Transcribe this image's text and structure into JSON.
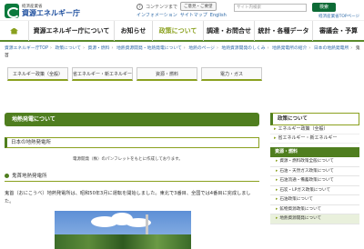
{
  "header": {
    "ministry": "経済産業省",
    "agency": "資源エネルギー庁",
    "util_contents_icon": "?",
    "util_contents": "コンテンツまで",
    "text_size_label": "ご意見・ご要望",
    "search_placeholder": "サイト内検索",
    "search_button": "検索",
    "links": [
      "インフォメーション",
      "サイトマップ",
      "English"
    ],
    "top_page_link": "経済産業省TOPページ"
  },
  "gnav": {
    "items": [
      "ホーム",
      "資源エネルギー庁について",
      "お知らせ",
      "政策について",
      "調達・お問合せ",
      "統計・各種データ",
      "審議会・予算"
    ],
    "active_index": 3,
    "accent": "#8aa01e"
  },
  "breadcrumb": {
    "items": [
      "資源エネルギー庁TOP",
      "政策について",
      "資源・燃料",
      "地熱資源開発・地熱発電について",
      "地熱のページ",
      "地熱資源開発のしくみ",
      "地熱発電所の紹介",
      "日本の地熱発電所"
    ],
    "current": "鬼首"
  },
  "tabs": [
    "エネルギー政策（全般）",
    "省エネルギー・新エネルギー",
    "資源・燃料",
    "電力・ガス"
  ],
  "main": {
    "section_title": "地熱発電について",
    "subsection_title": "日本の地熱発電所",
    "caption": "電源開発（株）のパンフレットをもとに作成しております。",
    "plant_heading": "鬼首地熱発電所",
    "plant_body": "鬼首（おにこうべ）地熱発電所は、昭和50年3月に運転を開始しました。東北で3番目、全国では4番目に完成しました。"
  },
  "sidebar": {
    "head": "政策について",
    "links": [
      "エネルギー政策（全般）",
      "省エネルギー・新エネルギー"
    ],
    "category": "資源・燃料",
    "subitems": [
      "資源・燃料政策全般について",
      "石油・天然ガス政策について",
      "石油流通・備蓄政策について",
      "石炭・LPガス政策について",
      "石油政策について",
      "鉱物資源政策について",
      "地熱資源開発について"
    ],
    "active_sub_index": 6
  }
}
